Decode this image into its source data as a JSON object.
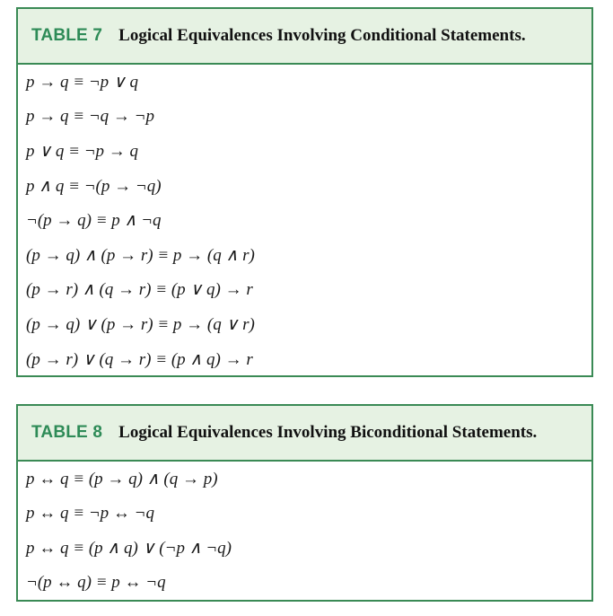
{
  "table7": {
    "number": "TABLE 7",
    "title": "Logical Equivalences Involving Conditional Statements.",
    "rows": [
      "p → q ≡ ¬p ∨ q",
      "p → q ≡ ¬q → ¬p",
      "p ∨ q ≡ ¬p → q",
      "p ∧ q ≡ ¬(p → ¬q)",
      "¬(p → q) ≡ p ∧ ¬q",
      "(p → q) ∧ (p → r) ≡ p → (q ∧ r)",
      "(p → r) ∧ (q → r) ≡ (p ∨ q) → r",
      "(p → q) ∨ (p → r) ≡ p → (q ∨ r)",
      "(p → r) ∨ (q → r) ≡ (p ∧ q) → r"
    ]
  },
  "table8": {
    "number": "TABLE 8",
    "title": "Logical Equivalences Involving Biconditional Statements.",
    "rows": [
      "p ↔ q ≡ (p → q) ∧ (q → p)",
      "p ↔ q ≡ ¬p ↔ ¬q",
      "p ↔ q ≡ (p ∧ q) ∨ (¬p ∧ ¬q)",
      "¬(p ↔ q) ≡ p ↔ ¬q"
    ]
  }
}
